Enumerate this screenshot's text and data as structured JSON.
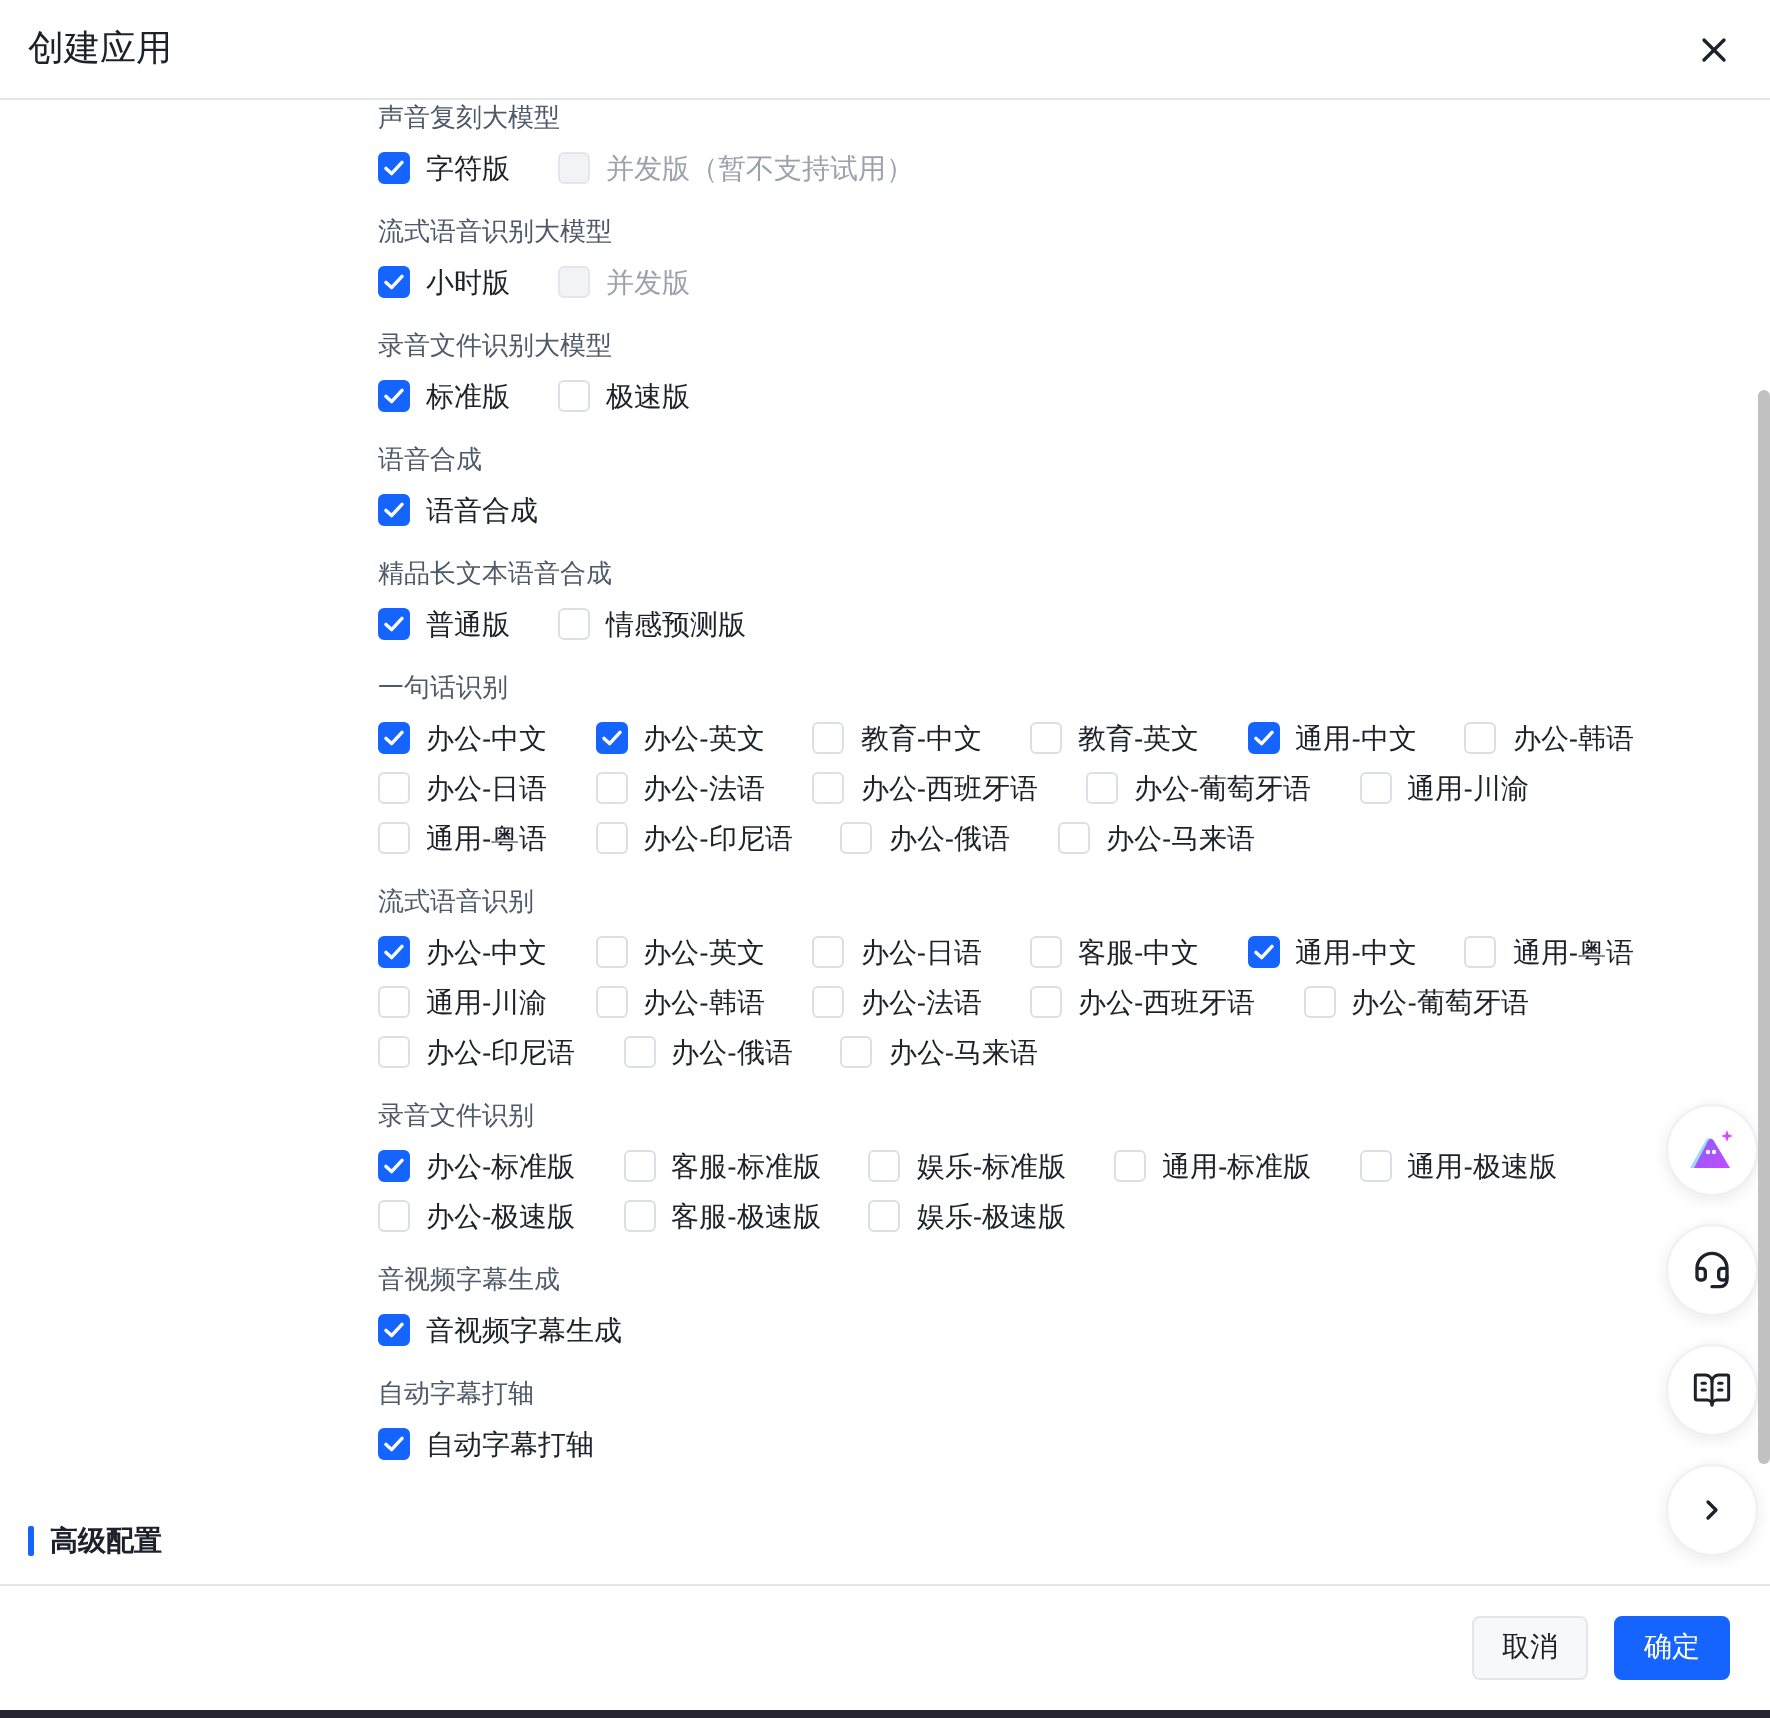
{
  "header": {
    "title": "创建应用"
  },
  "groups": [
    {
      "title": "声音复刻大模型",
      "rows": [
        [
          {
            "label": "字符版",
            "checked": true,
            "disabled": false
          },
          {
            "label": "并发版（暂不支持试用）",
            "checked": false,
            "disabled": true
          }
        ]
      ]
    },
    {
      "title": "流式语音识别大模型",
      "rows": [
        [
          {
            "label": "小时版",
            "checked": true,
            "disabled": false
          },
          {
            "label": "并发版",
            "checked": false,
            "disabled": true
          }
        ]
      ]
    },
    {
      "title": "录音文件识别大模型",
      "rows": [
        [
          {
            "label": "标准版",
            "checked": true,
            "disabled": false
          },
          {
            "label": "极速版",
            "checked": false,
            "disabled": false
          }
        ]
      ]
    },
    {
      "title": "语音合成",
      "rows": [
        [
          {
            "label": "语音合成",
            "checked": true,
            "disabled": false
          }
        ]
      ]
    },
    {
      "title": "精品长文本语音合成",
      "rows": [
        [
          {
            "label": "普通版",
            "checked": true,
            "disabled": false
          },
          {
            "label": "情感预测版",
            "checked": false,
            "disabled": false
          }
        ]
      ]
    },
    {
      "title": "一句话识别",
      "rows": [
        [
          {
            "label": "办公-中文",
            "checked": true,
            "disabled": false
          },
          {
            "label": "办公-英文",
            "checked": true,
            "disabled": false
          },
          {
            "label": "教育-中文",
            "checked": false,
            "disabled": false
          },
          {
            "label": "教育-英文",
            "checked": false,
            "disabled": false
          },
          {
            "label": "通用-中文",
            "checked": true,
            "disabled": false
          },
          {
            "label": "办公-韩语",
            "checked": false,
            "disabled": false
          }
        ],
        [
          {
            "label": "办公-日语",
            "checked": false,
            "disabled": false
          },
          {
            "label": "办公-法语",
            "checked": false,
            "disabled": false
          },
          {
            "label": "办公-西班牙语",
            "checked": false,
            "disabled": false
          },
          {
            "label": "办公-葡萄牙语",
            "checked": false,
            "disabled": false
          },
          {
            "label": "通用-川渝",
            "checked": false,
            "disabled": false
          }
        ],
        [
          {
            "label": "通用-粤语",
            "checked": false,
            "disabled": false
          },
          {
            "label": "办公-印尼语",
            "checked": false,
            "disabled": false
          },
          {
            "label": "办公-俄语",
            "checked": false,
            "disabled": false
          },
          {
            "label": "办公-马来语",
            "checked": false,
            "disabled": false
          }
        ]
      ]
    },
    {
      "title": "流式语音识别",
      "rows": [
        [
          {
            "label": "办公-中文",
            "checked": true,
            "disabled": false
          },
          {
            "label": "办公-英文",
            "checked": false,
            "disabled": false
          },
          {
            "label": "办公-日语",
            "checked": false,
            "disabled": false
          },
          {
            "label": "客服-中文",
            "checked": false,
            "disabled": false
          },
          {
            "label": "通用-中文",
            "checked": true,
            "disabled": false
          },
          {
            "label": "通用-粤语",
            "checked": false,
            "disabled": false
          }
        ],
        [
          {
            "label": "通用-川渝",
            "checked": false,
            "disabled": false
          },
          {
            "label": "办公-韩语",
            "checked": false,
            "disabled": false
          },
          {
            "label": "办公-法语",
            "checked": false,
            "disabled": false
          },
          {
            "label": "办公-西班牙语",
            "checked": false,
            "disabled": false
          },
          {
            "label": "办公-葡萄牙语",
            "checked": false,
            "disabled": false
          }
        ],
        [
          {
            "label": "办公-印尼语",
            "checked": false,
            "disabled": false
          },
          {
            "label": "办公-俄语",
            "checked": false,
            "disabled": false
          },
          {
            "label": "办公-马来语",
            "checked": false,
            "disabled": false
          }
        ]
      ]
    },
    {
      "title": "录音文件识别",
      "rows": [
        [
          {
            "label": "办公-标准版",
            "checked": true,
            "disabled": false
          },
          {
            "label": "客服-标准版",
            "checked": false,
            "disabled": false
          },
          {
            "label": "娱乐-标准版",
            "checked": false,
            "disabled": false
          },
          {
            "label": "通用-标准版",
            "checked": false,
            "disabled": false
          },
          {
            "label": "通用-极速版",
            "checked": false,
            "disabled": false
          }
        ],
        [
          {
            "label": "办公-极速版",
            "checked": false,
            "disabled": false
          },
          {
            "label": "客服-极速版",
            "checked": false,
            "disabled": false
          },
          {
            "label": "娱乐-极速版",
            "checked": false,
            "disabled": false
          }
        ]
      ]
    },
    {
      "title": "音视频字幕生成",
      "rows": [
        [
          {
            "label": "音视频字幕生成",
            "checked": true,
            "disabled": false
          }
        ]
      ]
    },
    {
      "title": "自动字幕打轴",
      "rows": [
        [
          {
            "label": "自动字幕打轴",
            "checked": true,
            "disabled": false
          }
        ]
      ]
    }
  ],
  "section": {
    "title": "高级配置"
  },
  "footer": {
    "buttons": [
      {
        "label": "取消",
        "kind": "secondary"
      },
      {
        "label": "确定",
        "kind": "primary"
      }
    ]
  }
}
